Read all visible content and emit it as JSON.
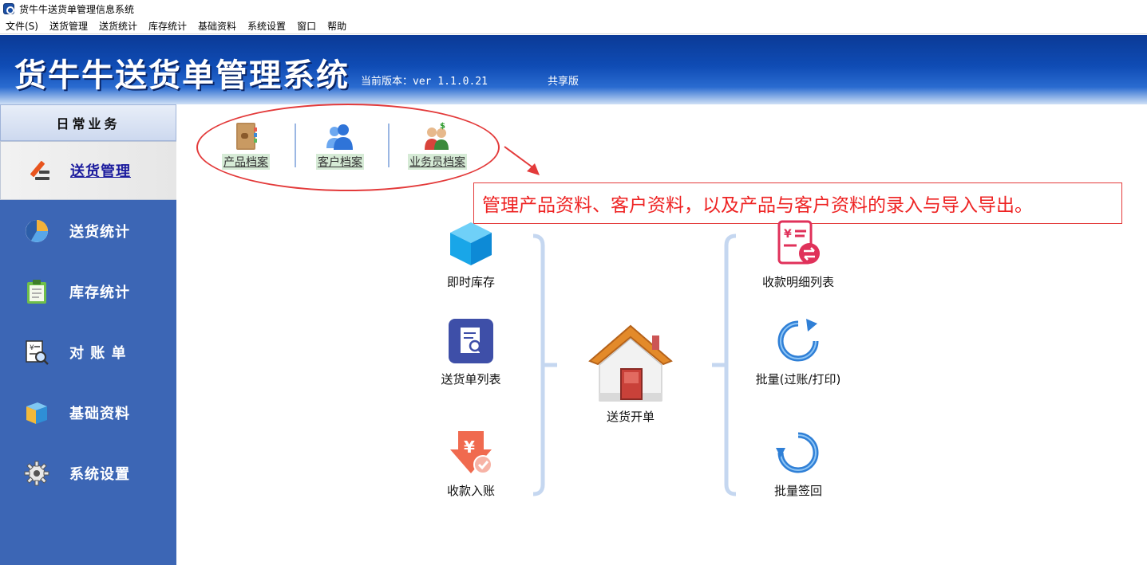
{
  "window": {
    "title": "货牛牛送货单管理信息系统"
  },
  "menubar": [
    "文件(S)",
    "送货管理",
    "送货统计",
    "库存统计",
    "基础资料",
    "系统设置",
    "窗口",
    "帮助"
  ],
  "banner": {
    "title": "货牛牛送货单管理系统",
    "version": "当前版本：ver 1.1.0.21",
    "edition": "共享版"
  },
  "sidebar": {
    "header": "日常业务",
    "items": [
      {
        "label": "送货管理",
        "icon": "pen-icon",
        "active": true
      },
      {
        "label": "送货统计",
        "icon": "pie-chart-icon"
      },
      {
        "label": "库存统计",
        "icon": "clipboard-icon"
      },
      {
        "label": "对 账 单",
        "icon": "statement-search-icon"
      },
      {
        "label": "基础资料",
        "icon": "box-icon"
      },
      {
        "label": "系统设置",
        "icon": "gear-icon"
      }
    ]
  },
  "top_links": [
    {
      "label": "产品档案",
      "icon": "product-book-icon"
    },
    {
      "label": "客户档案",
      "icon": "customers-icon"
    },
    {
      "label": "业务员档案",
      "icon": "salesman-icon"
    }
  ],
  "callout": {
    "text": "管理产品资料、客户资料，以及产品与客户资料的录入与导入导出。"
  },
  "nodes": {
    "instant_stock": "即时库存",
    "delivery_list": "送货单列表",
    "receipt_entry": "收款入账",
    "new_delivery": "送货开单",
    "receipt_detail": "收款明细列表",
    "batch_post": "批量(过账/打印)",
    "batch_signback": "批量签回"
  },
  "colors": {
    "banner": "#0f4cb5",
    "sidebar": "#3c66b5",
    "callout_red": "#e22222",
    "bracket": "#c5d7f0"
  }
}
